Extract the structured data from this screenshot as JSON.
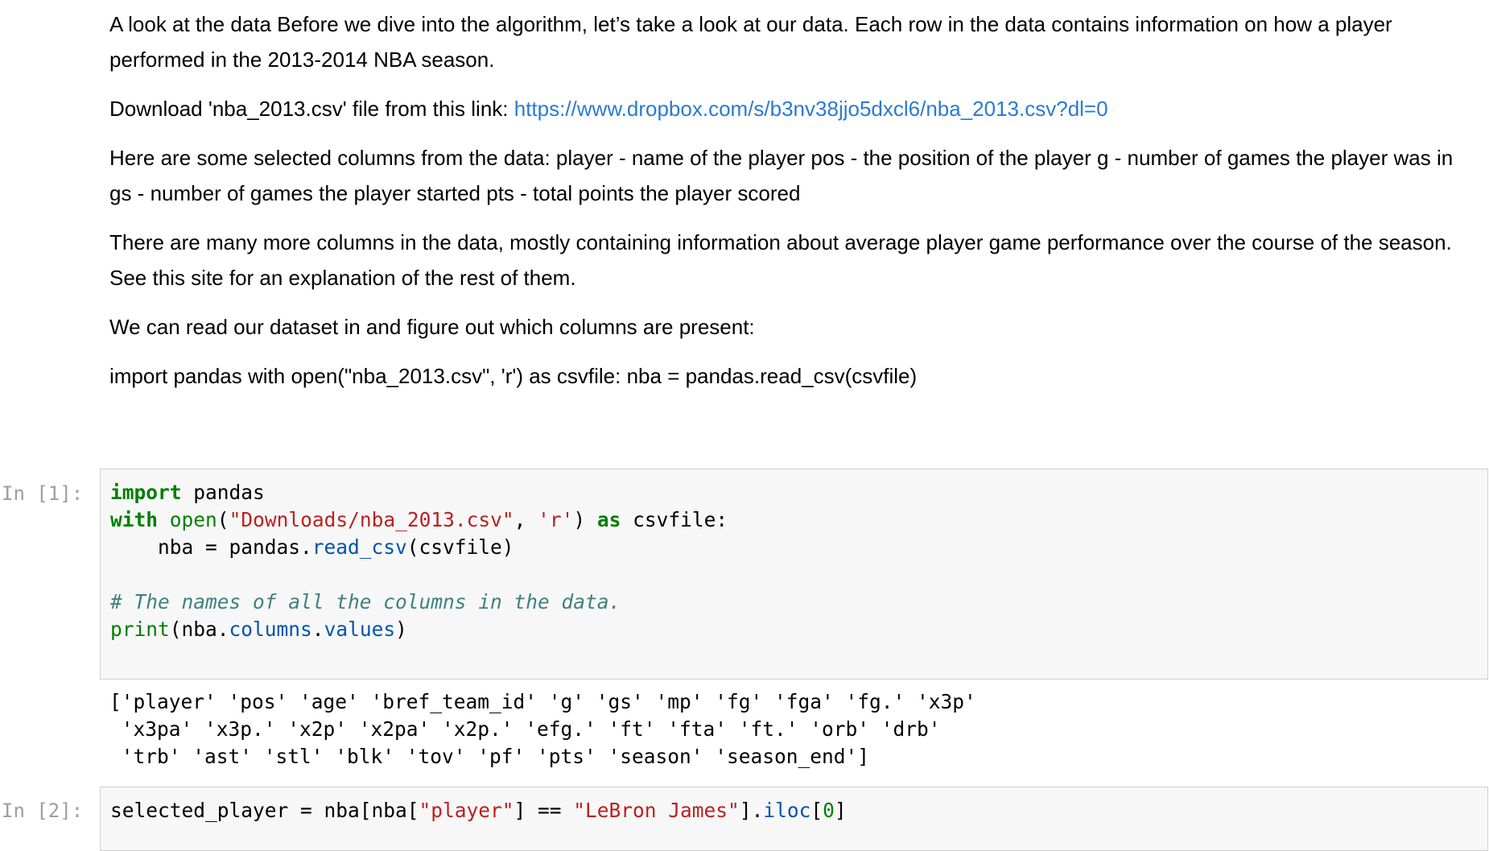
{
  "markdown": {
    "p1": "A look at the data Before we dive into the algorithm, let’s take a look at our data. Each row in the data contains information on how a player performed in the 2013-2014 NBA season.",
    "p2_prefix": "Download 'nba_2013.csv' file from this link: ",
    "p2_link": "https://www.dropbox.com/s/b3nv38jjo5dxcl6/nba_2013.csv?dl=0",
    "p3": "Here are some selected columns from the data: player - name of the player pos - the position of the player g - number of games the player was in gs - number of games the player started pts - total points the player scored",
    "p4": "There are many more columns in the data, mostly containing information about average player game performance over the course of the season. See this site for an explanation of the rest of them.",
    "p5": "We can read our dataset in and figure out which columns are present:",
    "p6": "import pandas with open(\"nba_2013.csv\", 'r') as csvfile: nba = pandas.read_csv(csvfile)"
  },
  "cell1": {
    "prompt": "In [1]:",
    "kw_import": "import",
    "mod_pandas": " pandas",
    "kw_with": "with",
    "sp1": " ",
    "fn_open": "open",
    "paren_open": "(",
    "str_path": "\"Downloads/nba_2013.csv\"",
    "comma": ", ",
    "str_mode": "'r'",
    "paren_close": ") ",
    "kw_as": "as",
    "csvfile_colon": " csvfile:",
    "line3_prefix": "    nba = pandas.",
    "fn_read_csv": "read_csv",
    "line3_suffix": "(csvfile)",
    "comment": "# The names of all the columns in the data.",
    "fn_print": "print",
    "line6_mid": "(nba.",
    "attr_columns": "columns",
    "dot": ".",
    "attr_values": "values",
    "line6_end": ")"
  },
  "output1": {
    "line1": "['player' 'pos' 'age' 'bref_team_id' 'g' 'gs' 'mp' 'fg' 'fga' 'fg.' 'x3p'",
    "line2": " 'x3pa' 'x3p.' 'x2p' 'x2pa' 'x2p.' 'efg.' 'ft' 'fta' 'ft.' 'orb' 'drb'",
    "line3": " 'trb' 'ast' 'stl' 'blk' 'tov' 'pf' 'pts' 'season' 'season_end']"
  },
  "cell2": {
    "prompt": "In [2]:",
    "prefix": "selected_player = nba[nba[",
    "str_player": "\"player\"",
    "mid": "] == ",
    "str_name": "\"LeBron James\"",
    "after": "].",
    "fn_iloc": "iloc",
    "bracket_open": "[",
    "num_zero": "0",
    "bracket_close": "]"
  }
}
